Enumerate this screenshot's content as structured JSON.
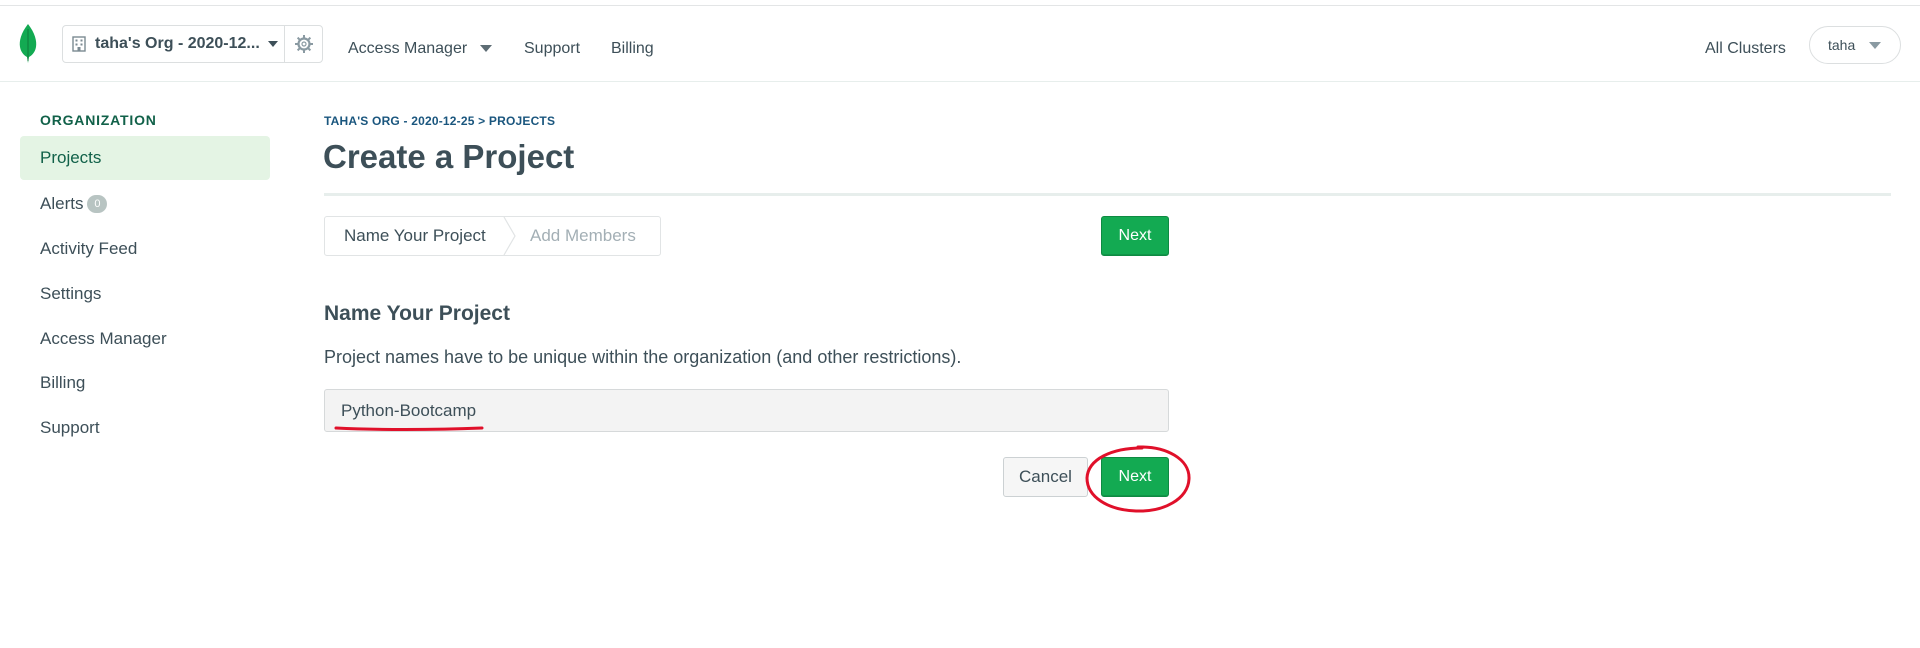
{
  "header": {
    "org_name": "taha's Org - 2020-12...",
    "nav": {
      "access_manager": "Access Manager",
      "support": "Support",
      "billing": "Billing"
    },
    "all_clusters": "All Clusters",
    "user_name": "taha"
  },
  "sidebar": {
    "heading": "ORGANIZATION",
    "items": [
      {
        "label": "Projects",
        "active": true
      },
      {
        "label": "Alerts",
        "badge": "0"
      },
      {
        "label": "Activity Feed"
      },
      {
        "label": "Settings"
      },
      {
        "label": "Access Manager"
      },
      {
        "label": "Billing"
      },
      {
        "label": "Support"
      }
    ]
  },
  "main": {
    "breadcrumb": "TAHA'S ORG - 2020-12-25 > PROJECTS",
    "title": "Create a Project",
    "steps": [
      "Name Your Project",
      "Add Members"
    ],
    "next_label": "Next",
    "section_title": "Name Your Project",
    "description": "Project names have to be unique within the organization (and other restrictions).",
    "project_name_value": "Python-Bootcamp",
    "cancel_label": "Cancel"
  },
  "colors": {
    "brand_green": "#13aa52",
    "active_bg": "#e4f4e4",
    "heading_green": "#116149",
    "breadcrumb_blue": "#1a567e",
    "annotation_red": "#e0102a"
  }
}
